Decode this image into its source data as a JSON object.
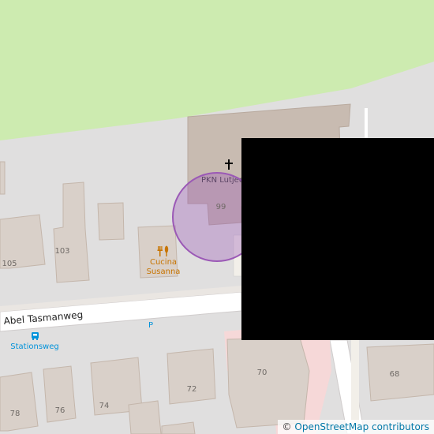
{
  "map": {
    "street_names": [
      "Abel Tasmanweg"
    ],
    "bus_stop_label": "Stationsweg",
    "parking_label": "P",
    "church_label": "PKN Lutjee",
    "restaurant_name_line1": "Cucina",
    "restaurant_name_line2": "Susanna",
    "house_numbers": [
      "99",
      "105",
      "103",
      "70",
      "72",
      "74",
      "76",
      "78",
      "68"
    ],
    "selection_circle_color": "#9b59b6",
    "colors": {
      "grass": "#cdebb0",
      "background": "#e0dfdf",
      "building": "#d9d0c9",
      "building_outline": "#c4b6ab",
      "church_building": "#c8bbb1",
      "road": "#ffffff",
      "pedestrian": "#f6d8d8",
      "poi_orange": "#c77400",
      "bus_blue": "#0092da"
    }
  },
  "attribution": {
    "prefix": "©",
    "link_text": "OpenStreetMap contributors"
  }
}
